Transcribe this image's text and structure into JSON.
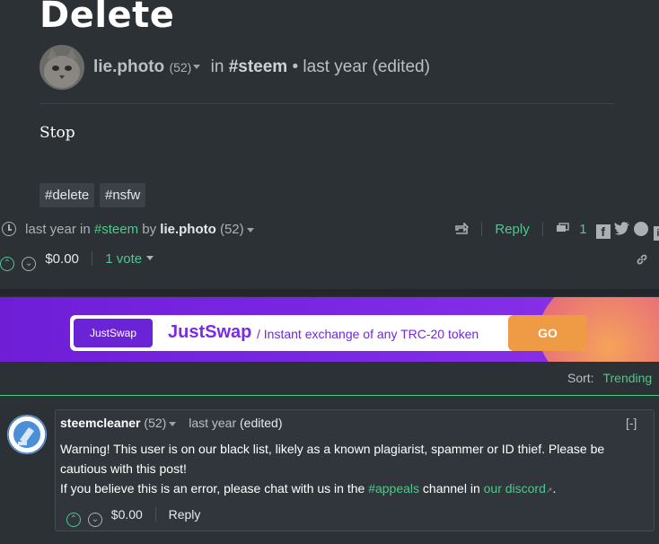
{
  "post": {
    "title": "Delete",
    "author": "lie.photo",
    "reputation": "(52)",
    "in_label": "in",
    "community_tag": "#steem",
    "time": "• last year (edited)",
    "body": "Stop",
    "tags": [
      "#delete",
      "#nsfw"
    ]
  },
  "footer": {
    "time": "last year in",
    "community": "#steem",
    "by_label": "by",
    "author": "lie.photo",
    "reputation": "(52)",
    "reply_label": "Reply",
    "comment_count": "1",
    "payout": "$0.00",
    "votes": "1 vote"
  },
  "banner": {
    "logo_text": "JustSwap",
    "brand": "JustSwap",
    "slogan": "/ Instant exchange of any TRC-20 token",
    "go_label": "GO"
  },
  "sort": {
    "label": "Sort:",
    "value": "Trending"
  },
  "comment": {
    "author": "steemcleaner",
    "reputation": "(52)",
    "time": "last year",
    "edited": "(edited)",
    "collapse": "[-]",
    "line1": "Warning! This user is on our black list, likely as a known plagiarist, spammer or ID thief. Please be cautious with this post!",
    "line2_a": "If you believe this is an error, please chat with us in the",
    "channel": "#appeals",
    "line2_b": "channel in",
    "discord": "our discord",
    "line2_c": ".",
    "payout": "$0.00",
    "reply_label": "Reply"
  },
  "colors": {
    "accent": "#4fc88a",
    "background": "#2c3136",
    "banner_purple": "#7a27e4",
    "go_orange": "#ef9a45"
  }
}
